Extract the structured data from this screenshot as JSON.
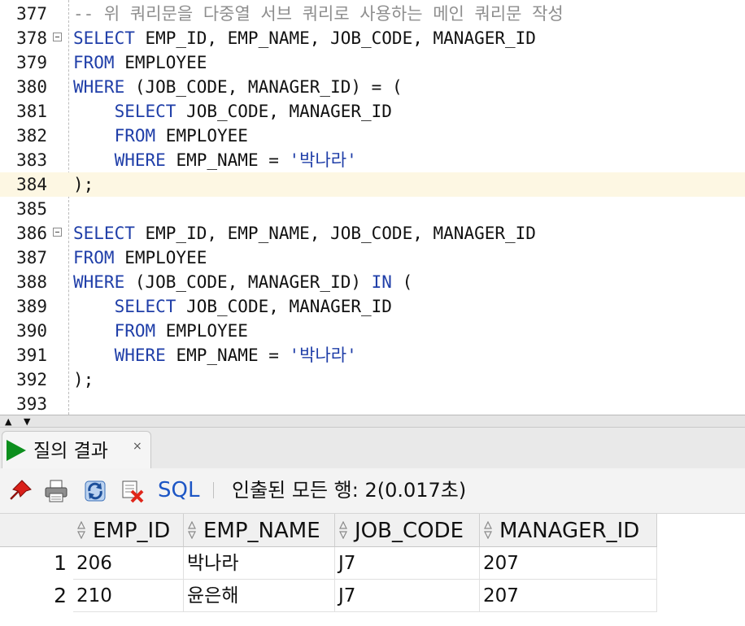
{
  "editor": {
    "lines": [
      {
        "num": "377",
        "indent": "",
        "fold": false,
        "hl": false,
        "tokens": [
          {
            "t": "-- 위 쿼리문을 다중열 서브 쿼리로 사용하는 메인 쿼리문 작성",
            "c": "cm"
          }
        ]
      },
      {
        "num": "378",
        "indent": "",
        "fold": true,
        "hl": false,
        "tokens": [
          {
            "t": "SELECT",
            "c": "kw"
          },
          {
            "t": " EMP_ID, EMP_NAME, JOB_CODE, MANAGER_ID",
            "c": ""
          }
        ]
      },
      {
        "num": "379",
        "indent": "",
        "fold": false,
        "hl": false,
        "tokens": [
          {
            "t": "FROM",
            "c": "kw"
          },
          {
            "t": " EMPLOYEE",
            "c": ""
          }
        ]
      },
      {
        "num": "380",
        "indent": "",
        "fold": false,
        "hl": false,
        "tokens": [
          {
            "t": "WHERE",
            "c": "kw"
          },
          {
            "t": " (JOB_CODE, MANAGER_ID) = (",
            "c": ""
          }
        ]
      },
      {
        "num": "381",
        "indent": "    ",
        "fold": false,
        "hl": false,
        "tokens": [
          {
            "t": "SELECT",
            "c": "kw"
          },
          {
            "t": " JOB_CODE, MANAGER_ID",
            "c": ""
          }
        ]
      },
      {
        "num": "382",
        "indent": "    ",
        "fold": false,
        "hl": false,
        "tokens": [
          {
            "t": "FROM",
            "c": "kw"
          },
          {
            "t": " EMPLOYEE",
            "c": ""
          }
        ]
      },
      {
        "num": "383",
        "indent": "    ",
        "fold": false,
        "hl": false,
        "tokens": [
          {
            "t": "WHERE",
            "c": "kw"
          },
          {
            "t": " EMP_NAME = ",
            "c": ""
          },
          {
            "t": "'박나라'",
            "c": "str"
          }
        ]
      },
      {
        "num": "384",
        "indent": "",
        "fold": false,
        "hl": true,
        "tokens": [
          {
            "t": ");",
            "c": ""
          }
        ]
      },
      {
        "num": "385",
        "indent": "",
        "fold": false,
        "hl": false,
        "tokens": []
      },
      {
        "num": "386",
        "indent": "",
        "fold": true,
        "hl": false,
        "tokens": [
          {
            "t": "SELECT",
            "c": "kw"
          },
          {
            "t": " EMP_ID, EMP_NAME, JOB_CODE, MANAGER_ID",
            "c": ""
          }
        ]
      },
      {
        "num": "387",
        "indent": "",
        "fold": false,
        "hl": false,
        "tokens": [
          {
            "t": "FROM",
            "c": "kw"
          },
          {
            "t": " EMPLOYEE",
            "c": ""
          }
        ]
      },
      {
        "num": "388",
        "indent": "",
        "fold": false,
        "hl": false,
        "tokens": [
          {
            "t": "WHERE",
            "c": "kw"
          },
          {
            "t": " (JOB_CODE, MANAGER_ID) ",
            "c": ""
          },
          {
            "t": "IN",
            "c": "kw"
          },
          {
            "t": " (",
            "c": ""
          }
        ]
      },
      {
        "num": "389",
        "indent": "    ",
        "fold": false,
        "hl": false,
        "tokens": [
          {
            "t": "SELECT",
            "c": "kw"
          },
          {
            "t": " JOB_CODE, MANAGER_ID",
            "c": ""
          }
        ]
      },
      {
        "num": "390",
        "indent": "    ",
        "fold": false,
        "hl": false,
        "tokens": [
          {
            "t": "FROM",
            "c": "kw"
          },
          {
            "t": " EMPLOYEE",
            "c": ""
          }
        ]
      },
      {
        "num": "391",
        "indent": "    ",
        "fold": false,
        "hl": false,
        "tokens": [
          {
            "t": "WHERE",
            "c": "kw"
          },
          {
            "t": " EMP_NAME = ",
            "c": ""
          },
          {
            "t": "'박나라'",
            "c": "str"
          }
        ]
      },
      {
        "num": "392",
        "indent": "",
        "fold": false,
        "hl": false,
        "tokens": [
          {
            "t": ");",
            "c": ""
          }
        ]
      },
      {
        "num": "393",
        "indent": "",
        "fold": false,
        "hl": false,
        "tokens": []
      }
    ]
  },
  "result_tab": {
    "label": "질의 결과",
    "close": "×",
    "icon": "run-triangle-icon"
  },
  "toolbar": {
    "icons": [
      "pin-icon",
      "print-icon",
      "refresh-icon",
      "clear-icon"
    ],
    "sql_label": "SQL",
    "status": "인출된 모든 행: 2(0.017초)"
  },
  "grid": {
    "columns": [
      "EMP_ID",
      "EMP_NAME",
      "JOB_CODE",
      "MANAGER_ID"
    ],
    "rows": [
      {
        "num": "1",
        "cells": [
          "206",
          "박나라",
          "J7",
          "207"
        ]
      },
      {
        "num": "2",
        "cells": [
          "210",
          "윤은해",
          "J7",
          "207"
        ]
      }
    ]
  },
  "colors": {
    "keyword": "#1f3ea8",
    "comment": "#8e8e8e",
    "current_line": "#fdf7e3",
    "run_icon": "#0d8f1e",
    "sql_link": "#1d56c5"
  }
}
